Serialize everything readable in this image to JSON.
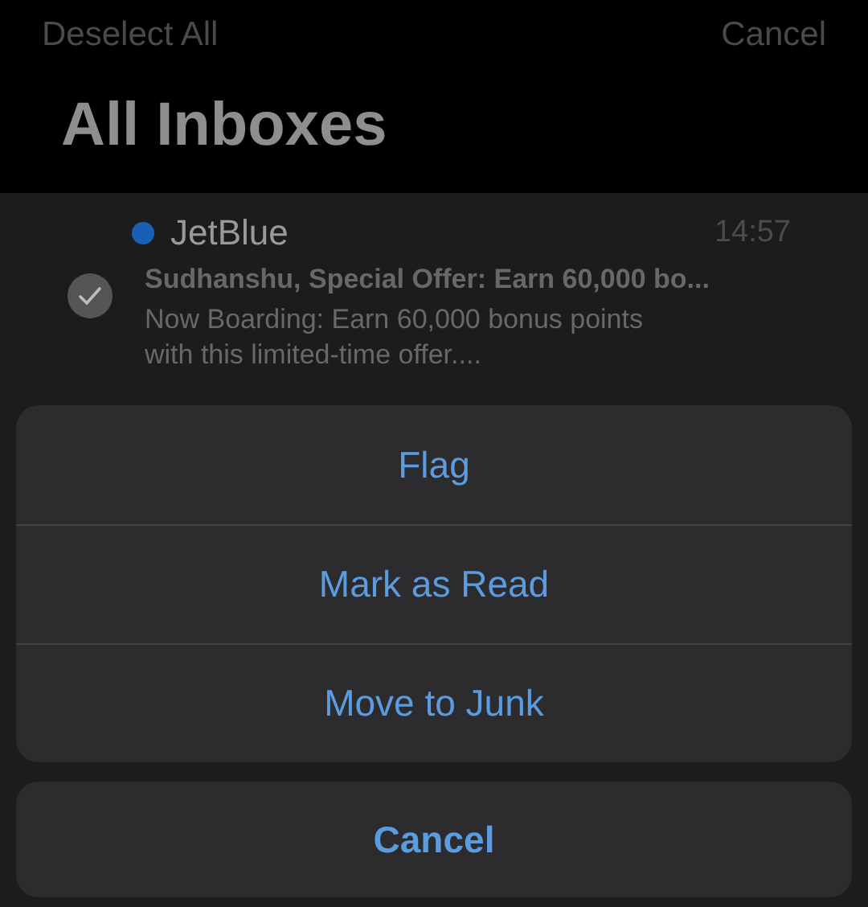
{
  "nav": {
    "left_button": "Deselect All",
    "right_button": "Cancel"
  },
  "title": "All Inboxes",
  "messages": [
    {
      "sender": "JetBlue",
      "time": "14:57",
      "unread": true,
      "selected": true,
      "subject": "Sudhanshu, Special Offer: Earn 60,000 bo...",
      "preview": "Now Boarding: Earn 60,000 bonus points with this limited-time offer...."
    }
  ],
  "action_sheet": {
    "actions": [
      "Flag",
      "Mark as Read",
      "Move to Junk"
    ],
    "cancel": "Cancel"
  }
}
